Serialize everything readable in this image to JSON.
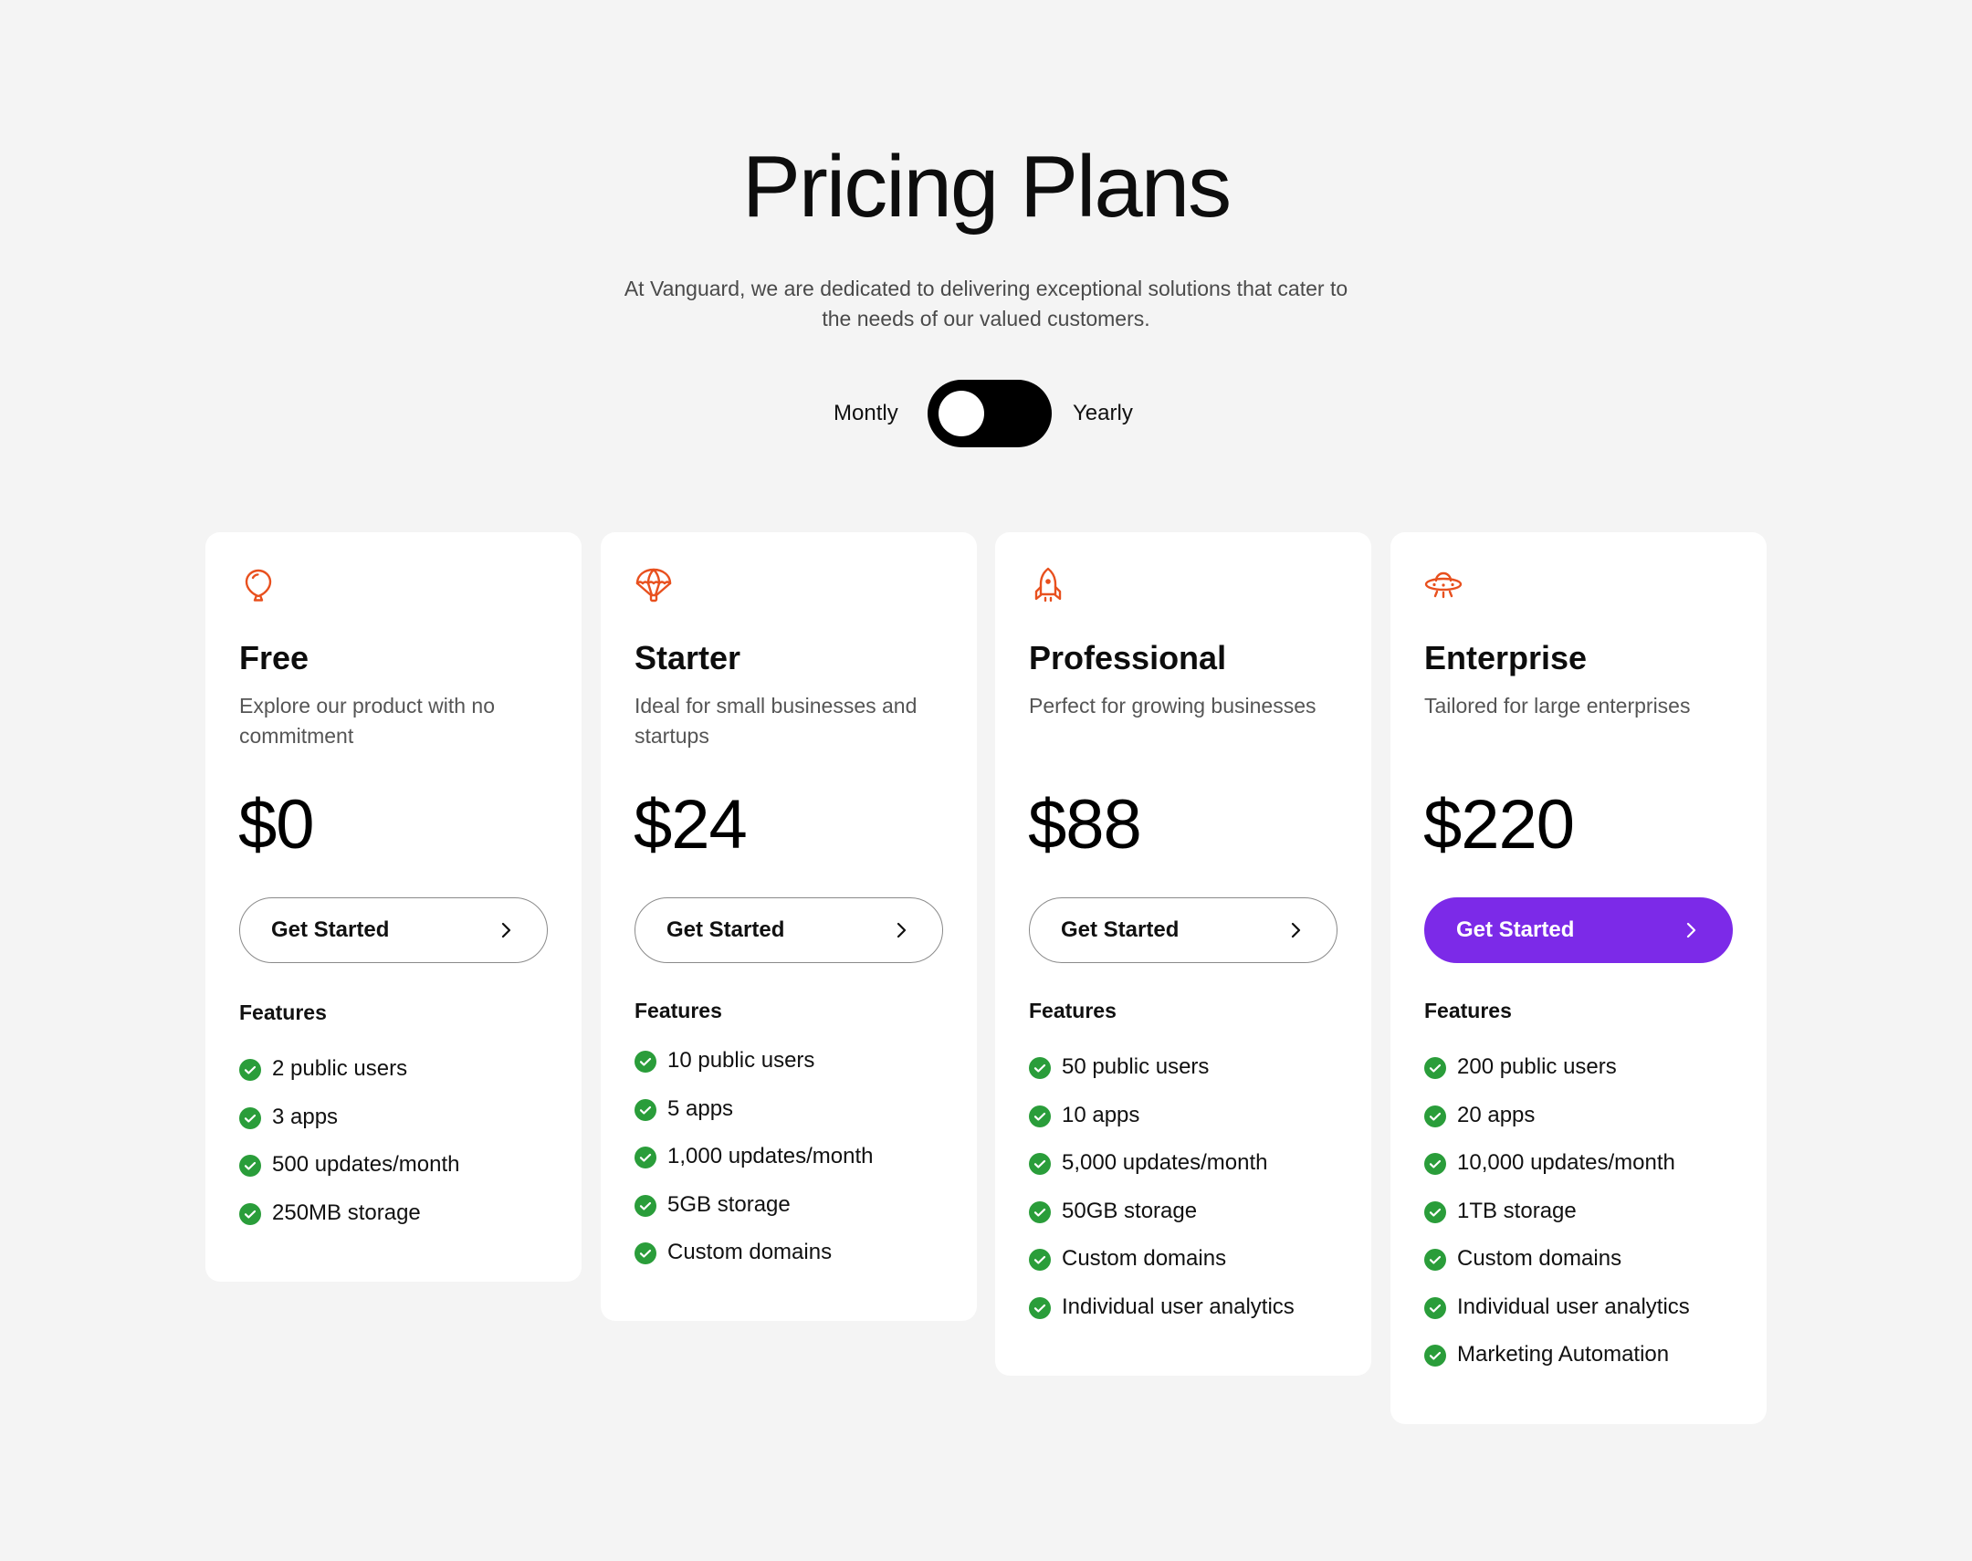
{
  "header": {
    "title": "Pricing Plans",
    "subtitle": "At Vanguard, we are dedicated to delivering exceptional solutions that cater to the needs of our valued customers."
  },
  "billing": {
    "monthly_label": "Montly",
    "yearly_label": "Yearly",
    "selected": "Montly"
  },
  "colors": {
    "accent": "#7c2ae8",
    "icon": "#e8501e",
    "check": "#2a9d3a",
    "background": "#f4f4f4"
  },
  "plans": [
    {
      "icon": "balloon-icon",
      "name": "Free",
      "description": "Explore our product with no commitment",
      "price": "$0",
      "cta_label": "Get Started",
      "features_heading": "Features",
      "features": [
        "2 public users",
        "3 apps",
        "500 updates/month",
        "250MB storage"
      ]
    },
    {
      "icon": "parachute-icon",
      "name": "Starter",
      "description": "Ideal for small businesses and startups",
      "price": "$24",
      "cta_label": "Get Started",
      "features_heading": "Features",
      "features": [
        "10 public users",
        "5 apps",
        "1,000 updates/month",
        "5GB storage",
        "Custom domains"
      ]
    },
    {
      "icon": "rocket-icon",
      "name": "Professional",
      "description": "Perfect for growing businesses",
      "price": "$88",
      "cta_label": "Get Started",
      "features_heading": "Features",
      "features": [
        "50 public users",
        "10 apps",
        "5,000 updates/month",
        "50GB storage",
        "Custom domains",
        "Individual user analytics"
      ]
    },
    {
      "icon": "ufo-icon",
      "name": "Enterprise",
      "description": "Tailored for large enterprises",
      "price": "$220",
      "cta_label": "Get Started",
      "features_heading": "Features",
      "features": [
        "200 public users",
        "20 apps",
        "10,000 updates/month",
        "1TB storage",
        "Custom domains",
        "Individual user analytics",
        "Marketing Automation"
      ]
    }
  ]
}
